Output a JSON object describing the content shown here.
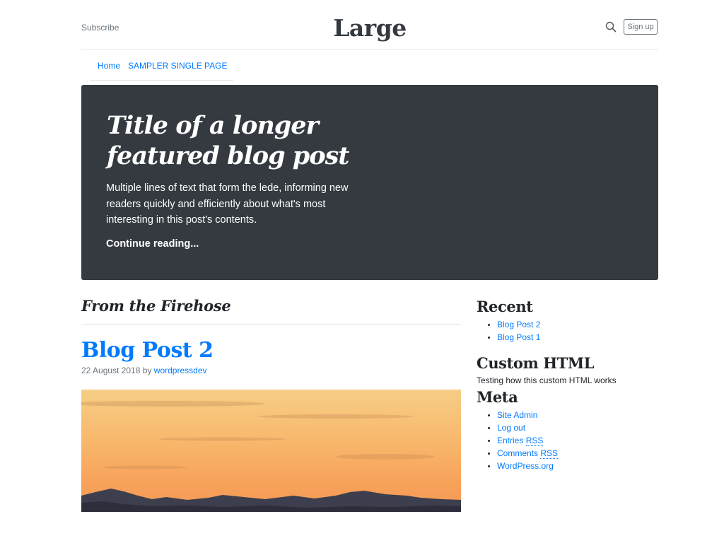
{
  "header": {
    "subscribe": "Subscribe",
    "brand": "Large",
    "signup": "Sign up"
  },
  "nav": {
    "items": [
      {
        "label": "Home"
      },
      {
        "label": "SAMPLER SINGLE PAGE"
      }
    ]
  },
  "hero": {
    "title": "Title of a longer featured blog post",
    "lede": "Multiple lines of text that form the lede, informing new readers quickly and efficiently about what's most interesting in this post's contents.",
    "continue": "Continue reading..."
  },
  "main": {
    "section_title": "From the Firehose",
    "post": {
      "title": "Blog Post 2",
      "date": "22 August 2018",
      "by": "by",
      "author": "wordpressdev"
    }
  },
  "sidebar": {
    "recent": {
      "title": "Recent",
      "items": [
        "Blog Post 2",
        "Blog Post 1"
      ]
    },
    "custom_html": {
      "title": "Custom HTML",
      "text": "Testing how this custom HTML works"
    },
    "meta": {
      "title": "Meta",
      "items": [
        {
          "label": "Site Admin"
        },
        {
          "label": "Log out"
        },
        {
          "label": "Entries",
          "abbr": "RSS"
        },
        {
          "label": "Comments",
          "abbr": "RSS"
        },
        {
          "label": "WordPress.org"
        }
      ]
    }
  },
  "colors": {
    "link": "#007bff",
    "hero_bg": "#343a40",
    "muted": "#6c757d",
    "text": "#212529"
  },
  "icons": {
    "search": "search-icon"
  }
}
